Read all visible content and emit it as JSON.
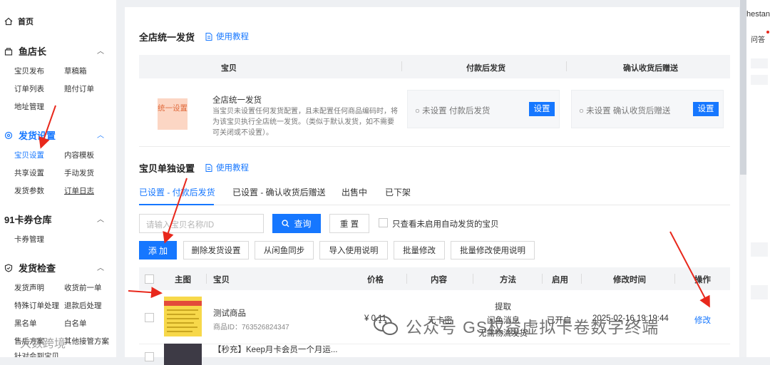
{
  "sidebar": {
    "home": "首页",
    "sections": [
      {
        "title": "鱼店长",
        "items": [
          "宝贝发布",
          "草稿箱",
          "订单列表",
          "赔付订单",
          "地址管理"
        ]
      },
      {
        "title": "发货设置",
        "items": [
          "宝贝设置",
          "内容模板",
          "共享设置",
          "手动发货",
          "发货参数",
          "订单日志"
        ]
      },
      {
        "title": "91卡券仓库",
        "items": [
          "卡券管理"
        ]
      },
      {
        "title": "发货检查",
        "items": [
          "发货声明",
          "收货前一单",
          "特殊订单处理",
          "退款后处理",
          "黑名单",
          "白名单",
          "售后方案",
          "其他接管方案",
          "针对会到宝贝"
        ]
      }
    ]
  },
  "global": {
    "title": "全店统一发货",
    "tutorial": "使用教程",
    "headers": [
      "宝贝",
      "付款后发货",
      "确认收货后赠送"
    ],
    "badge": "统一设置",
    "name": "全店统一发货",
    "desc": "当宝贝未设置任何发货配置，且未配置任何商品编码时，将为该宝贝执行全店统一发货。（类似于默认发货，如不需要可关闭或不设置）。",
    "pay_label": "○ 未设置 付款后发货",
    "confirm_label": "○ 未设置 确认收货后赠送",
    "set_btn": "设置"
  },
  "single": {
    "title": "宝贝单独设置",
    "tutorial": "使用教程",
    "tabs": [
      "已设置 - 付款后发货",
      "已设置 - 确认收货后赠送",
      "出售中",
      "已下架"
    ],
    "search_placeholder": "请输入宝贝名称/ID",
    "query_btn": "查询",
    "reset_btn": "重 置",
    "only_label": "只查看未启用自动发货的宝贝",
    "actions": [
      "添 加",
      "删除发货设置",
      "从闲鱼同步",
      "导入使用说明",
      "批量修改",
      "批量修改使用说明"
    ],
    "columns": [
      "主图",
      "宝贝",
      "价格",
      "内容",
      "方法",
      "启用",
      "修改时间",
      "操作"
    ],
    "rows": [
      {
        "name": "测试商品",
        "id": "商品ID：763526824347",
        "price": "¥ 0.11",
        "content": "无卡密",
        "method": [
          "提取",
          "闲鱼消息",
          "无需物流发货"
        ],
        "enabled": "已开启",
        "time": "2025-02-16 19:19:44",
        "op": "修改"
      },
      {
        "name": "【秒充】Keep月卡会员一个月运..."
      }
    ]
  },
  "right_panel": {
    "top": "hestan",
    "qa": "问答"
  },
  "watermark": {
    "brand": "公众号",
    "text": "GS权益虚拟卡卷数字终端",
    "bottom": "大数跨境"
  },
  "colors": {
    "accent": "#1677ff",
    "badge_bg": "#fcd6c4",
    "badge_text": "#e06a3c",
    "annotation": "#e8281c"
  }
}
